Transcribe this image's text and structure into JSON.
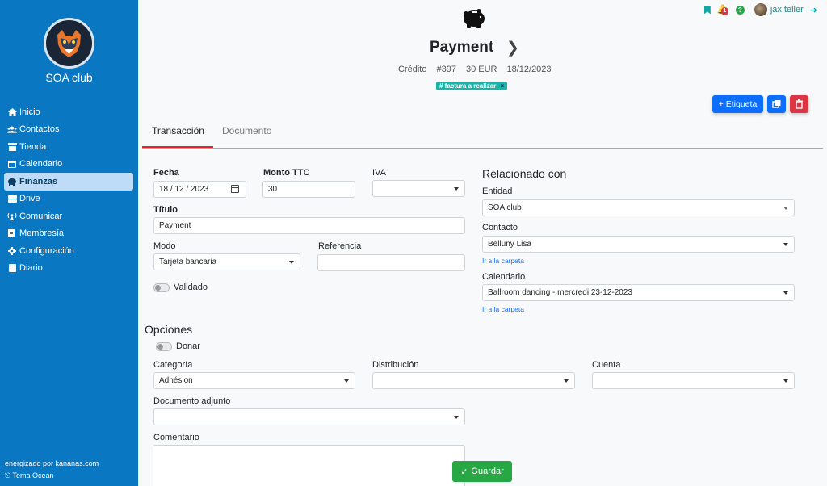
{
  "sidebar": {
    "club_name": "SOA club",
    "items": [
      {
        "label": "Inicio",
        "icon": "home-icon"
      },
      {
        "label": "Contactos",
        "icon": "users-icon"
      },
      {
        "label": "Tienda",
        "icon": "store-icon"
      },
      {
        "label": "Calendario",
        "icon": "calendar-icon"
      },
      {
        "label": "Finanzas",
        "icon": "piggy-bank-icon",
        "active": true
      },
      {
        "label": "Drive",
        "icon": "drive-icon"
      },
      {
        "label": "Comunicar",
        "icon": "broadcast-icon"
      },
      {
        "label": "Membresía",
        "icon": "membership-icon"
      },
      {
        "label": "Configuración",
        "icon": "gear-icon"
      },
      {
        "label": "Diario",
        "icon": "book-icon"
      }
    ],
    "powered_by": "energizado por kananas.com",
    "theme": "Tema Ocean"
  },
  "topbar": {
    "notification_count": "1",
    "help": "?",
    "user_name": "jax teller"
  },
  "header": {
    "title": "Payment",
    "type": "Crédito",
    "number": "#397",
    "amount": "30 EUR",
    "date": "18/12/2023",
    "tag": "# factura a realizar",
    "tag_remove": "×",
    "etiqueta_button": "+ Etiqueta"
  },
  "tabs": {
    "transaction": "Transacción",
    "document": "Documento"
  },
  "form": {
    "fecha_label": "Fecha",
    "fecha_value": "18 / 12 / 2023",
    "monto_label": "Monto TTC",
    "monto_value": "30",
    "iva_label": "IVA",
    "iva_value": "",
    "titulo_label": "Título",
    "titulo_value": "Payment",
    "modo_label": "Modo",
    "modo_value": "Tarjeta bancaria",
    "referencia_label": "Referencia",
    "referencia_value": "",
    "validado_label": "Validado"
  },
  "related": {
    "title": "Relacionado con",
    "entidad_label": "Entidad",
    "entidad_value": "SOA club",
    "contacto_label": "Contacto",
    "contacto_value": "Belluny Lisa",
    "contacto_link": "Ir a la carpeta",
    "calendario_label": "Calendario",
    "calendario_value": "Ballroom dancing - mercredi 23-12-2023",
    "calendario_link": "Ir a la carpeta"
  },
  "options": {
    "title": "Opciones",
    "donar_label": "Donar",
    "categoria_label": "Categoría",
    "categoria_value": "Adhésion",
    "distribucion_label": "Distribución",
    "distribucion_value": "",
    "cuenta_label": "Cuenta",
    "cuenta_value": "",
    "documento_label": "Documento adjunto",
    "documento_value": "",
    "comentario_label": "Comentario"
  },
  "save_button": "Guardar",
  "colors": {
    "sidebar": "#0a77c2",
    "primary": "#0d6efd",
    "danger": "#dc3545",
    "success": "#28a745",
    "tag": "#1fb3a8",
    "tab_active": "#e3232b"
  }
}
